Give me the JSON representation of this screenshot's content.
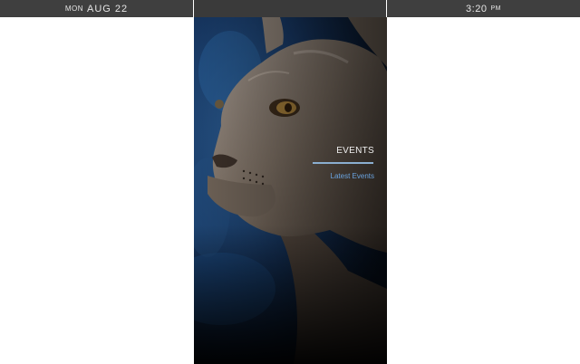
{
  "status_bar": {
    "day_of_week": "MON",
    "date": "AUG 22",
    "time": "3:20",
    "ampm": "PM"
  },
  "screen": {
    "background_image": "bronze-wildcat-statue",
    "menu": {
      "title": "EVENTS",
      "link_label": "Latest Events"
    }
  },
  "colors": {
    "status_bar": "#3f3f3f",
    "accent_link": "#6aa3df",
    "divider": "#8aaed0",
    "page": "#ffffff"
  }
}
